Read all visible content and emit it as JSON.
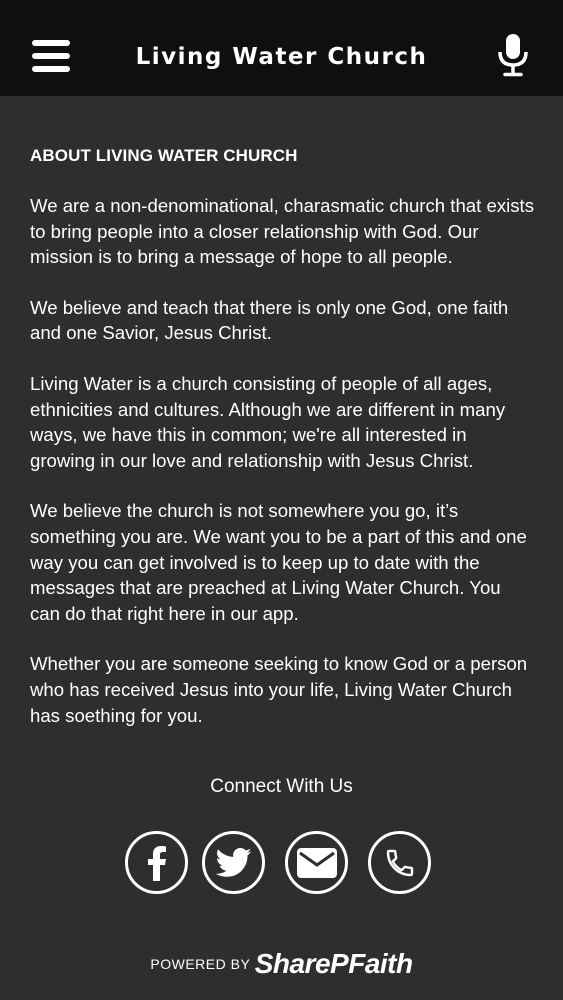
{
  "header": {
    "title": "Living Water Church",
    "menu_icon": "hamburger-menu-icon",
    "mic_icon": "microphone-icon"
  },
  "about": {
    "title": "ABOUT LIVING WATER CHURCH",
    "paragraphs": [
      "We are a non-denominational, charasmatic church that exists to bring people into a closer relationship with God. Our mission is to bring a message of hope to all people.",
      "We believe and teach that there is only one God, one faith and one Savior, Jesus Christ.",
      "Living Water is a church consisting of people of all ages, ethnicities and cultures. Although we are different in many ways, we have this in common; we're all interested in growing in our love and relationship with Jesus Christ.",
      "We believe the church is not somewhere you go, it’s something you are. We want you to be a part of this and one way you can get involved is to keep up to date with the messages that are preached at Living Water Church. You can do that right here in our app.",
      "Whether you are someone seeking to know God or a person who has received Jesus into your life, Living Water Church has soething for you."
    ]
  },
  "connect": {
    "label": "Connect With Us",
    "icons": [
      "facebook-icon",
      "twitter-icon",
      "email-icon",
      "phone-icon"
    ]
  },
  "footer": {
    "powered_by": "POWERED BY",
    "brand": "SharePFaith"
  },
  "colors": {
    "header_bg": "#0f0f0f",
    "body_bg": "#2e2e2e",
    "text": "#ffffff"
  }
}
